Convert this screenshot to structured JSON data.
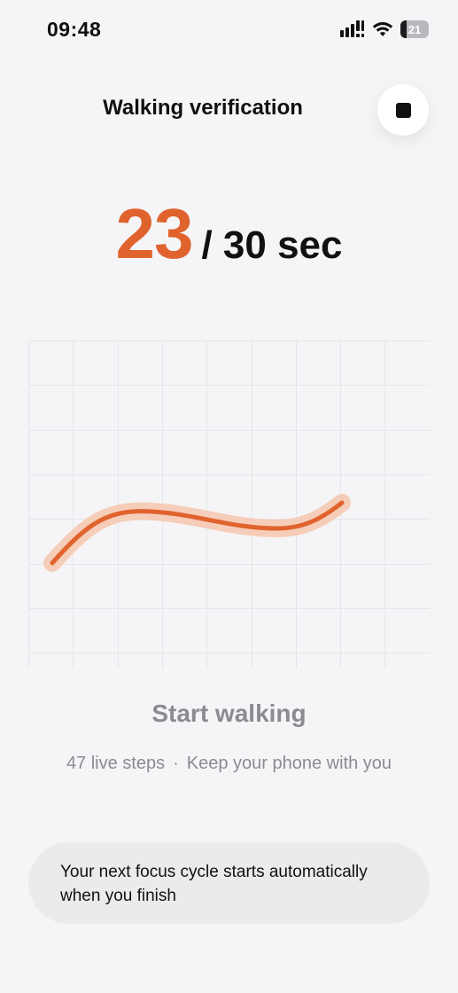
{
  "status_bar": {
    "time": "09:48",
    "battery_level": "21",
    "battery_fraction": 0.21,
    "icons": [
      "signal-icon",
      "wifi-icon",
      "battery-icon"
    ]
  },
  "header": {
    "title": "Walking verification",
    "stop_icon": "stop-icon"
  },
  "timer": {
    "elapsed": "23",
    "total": "/ 30 sec"
  },
  "colors": {
    "accent": "#e0632e",
    "accent_glow": "#f6cdb8",
    "muted_text": "#8b8b90",
    "background": "#f5f5f7",
    "card": "#ebebed"
  },
  "status": {
    "heading": "Start walking",
    "steps": "47 live steps",
    "separator": "·",
    "hint": "Keep your phone with you"
  },
  "info_card": {
    "text": "Your next focus cycle starts automatically when you finish"
  }
}
